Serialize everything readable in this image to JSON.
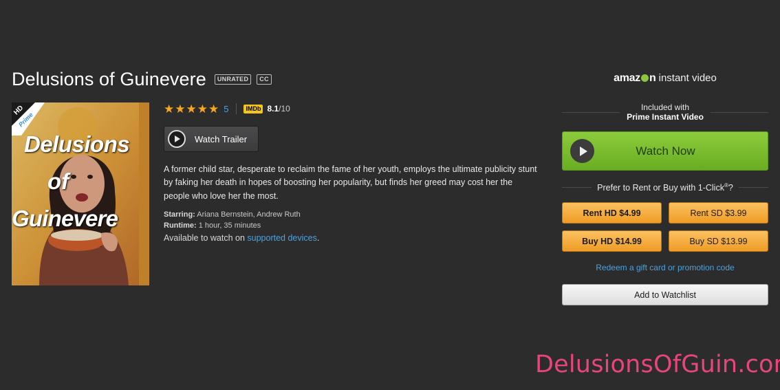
{
  "title": "Delusions of Guinevere",
  "badges": {
    "rating": "UNRATED",
    "cc": "CC"
  },
  "poster": {
    "corner_hd": "HD",
    "corner_prime": "Prime",
    "line1": "Delusions",
    "line2": "of",
    "line3": "Guinevere"
  },
  "rating": {
    "stars": 5,
    "count": "5",
    "imdb_label": "IMDb",
    "imdb_score": "8.1",
    "imdb_out_of": "/10"
  },
  "trailer": {
    "label": "Watch Trailer"
  },
  "description": "A former child star, desperate to reclaim the fame of her youth, employs the ultimate publicity stunt by faking her death in hopes of boosting her popularity, but finds her greed may cost her the people who love her the most.",
  "meta": {
    "starring_label": "Starring:",
    "starring": "Ariana Bernstein, Andrew Ruth",
    "runtime_label": "Runtime:",
    "runtime": "1 hour, 35 minutes",
    "available_prefix": "Available to watch on",
    "available_link": "supported devices",
    "available_suffix": "."
  },
  "sidebar": {
    "logo_amazon_pre": "amaz",
    "logo_amazon_post": "n",
    "logo_instant": "instant video",
    "included_line1": "Included with",
    "included_line2": "Prime Instant Video",
    "watch_now": "Watch Now",
    "prefer": "Prefer to Rent or Buy with 1-Click",
    "prefer_mark": "®",
    "prefer_q": "?",
    "buttons": [
      {
        "label": "Rent HD $4.99"
      },
      {
        "label": "Rent SD $3.99"
      },
      {
        "label": "Buy HD $14.99"
      },
      {
        "label": "Buy SD $13.99"
      }
    ],
    "redeem": "Redeem a gift card or promotion code",
    "watchlist": "Add to Watchlist"
  },
  "watermark": "DelusionsOfGuin.com",
  "colors": {
    "background": "#2c2c2d",
    "accent_green": "#7cbd30",
    "accent_orange": "#f5ad3f",
    "link_blue": "#4aa3df",
    "watermark_pink": "#e8457d",
    "star_gold": "#f7a81b"
  }
}
